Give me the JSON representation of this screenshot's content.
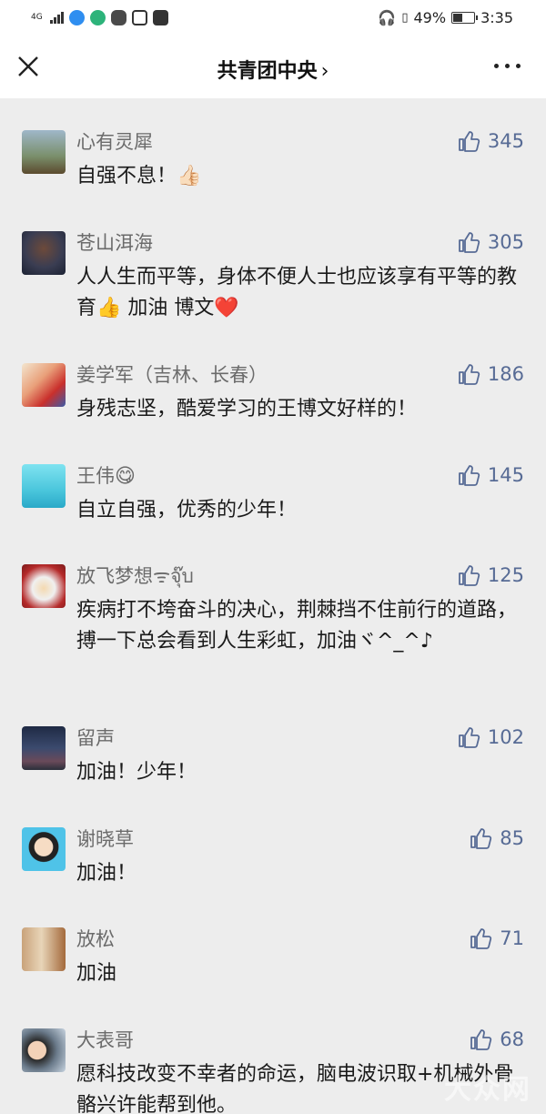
{
  "status_bar": {
    "network": "4G",
    "battery": "49%",
    "battery_level": 0.49,
    "time": "3:35"
  },
  "nav": {
    "title": "共青团中央",
    "chevron": "›"
  },
  "comments": [
    {
      "name": "心有灵犀",
      "likes": "345",
      "text": "自强不息！",
      "emoji": "👍🏻"
    },
    {
      "name": "苍山洱海",
      "likes": "305",
      "text": "人人生而平等，身体不便人士也应该享有平等的教育",
      "emoji": "👍",
      "text2": "加油 博文",
      "emoji2": "❤️"
    },
    {
      "name": "姜学军（吉林、长春）",
      "likes": "186",
      "text": "身残志坚，酷爱学习的王博文好样的！"
    },
    {
      "name": "王伟",
      "name_emoji": "😋",
      "likes": "145",
      "text": "自立自强，优秀的少年！"
    },
    {
      "name": "放飞梦想ᯤจุ๊บ",
      "likes": "125",
      "text": "疾病打不垮奋斗的决心，荆棘挡不住前行的道路，搏一下总会看到人生彩虹，加油ヾ^_^♪"
    },
    {
      "name": "留声",
      "likes": "102",
      "text": "加油！少年！"
    },
    {
      "name": "谢晓草",
      "likes": "85",
      "text": "加油！"
    },
    {
      "name": "放松",
      "likes": "71",
      "text": "加油"
    },
    {
      "name": "大表哥",
      "likes": "68",
      "text": "愿科技改变不幸者的命运，脑电波识取+机械外骨骼兴许能帮到他。"
    }
  ],
  "watermark": "大众网",
  "colors": {
    "accent": "#576b95",
    "background": "#ededed"
  }
}
